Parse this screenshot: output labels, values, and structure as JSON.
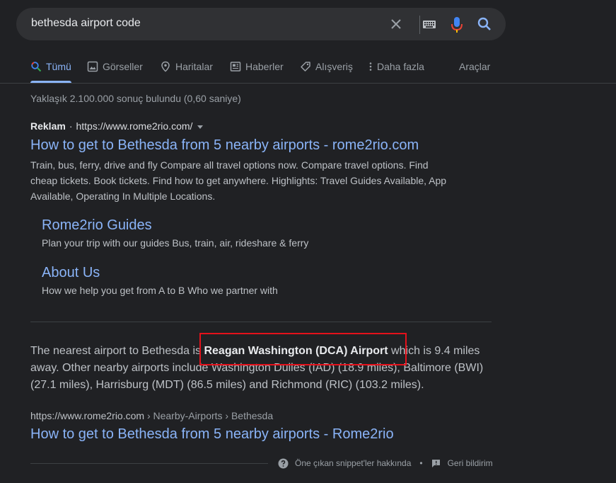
{
  "search": {
    "query": "bethesda airport code"
  },
  "tabs": [
    {
      "label": "Tümü",
      "icon": "search-icon",
      "active": true
    },
    {
      "label": "Görseller",
      "icon": "image-icon"
    },
    {
      "label": "Haritalar",
      "icon": "map-pin-icon"
    },
    {
      "label": "Haberler",
      "icon": "news-icon"
    },
    {
      "label": "Alışveriş",
      "icon": "tag-icon"
    },
    {
      "label": "Daha fazla",
      "icon": "more-vert-icon"
    }
  ],
  "tools_label": "Araçlar",
  "stats": "Yaklaşık 2.100.000 sonuç bulundu (0,60 saniye)",
  "ad": {
    "badge": "Reklam",
    "separator": "·",
    "url": "https://www.rome2rio.com/",
    "title": "How to get to Bethesda from 5 nearby airports - rome2rio.com",
    "description": "Train, bus, ferry, drive and fly Compare all travel options now. Compare travel options. Find cheap tickets. Book tickets. Find how to get anywhere. Highlights: Travel Guides Available, App Available, Operating In Multiple Locations.",
    "sitelinks": [
      {
        "title": "Rome2rio Guides",
        "desc": "Plan your trip with our guides Bus, train, air, rideshare & ferry"
      },
      {
        "title": "About Us",
        "desc": "How we help you get from A to B Who we partner with"
      }
    ]
  },
  "snippet": {
    "pre": "The nearest airport to Bethesda is ",
    "bold": "Reagan Washington (DCA) Airport",
    "post": " which is 9.4 miles away. Other nearby airports include Washington Dulles (IAD) (18.9 miles), Baltimore (BWI) (27.1 miles), Harrisburg (MDT) (86.5 miles) and Richmond (RIC) (103.2 miles)."
  },
  "result": {
    "domain": "https://www.rome2rio.com",
    "path": " › Nearby-Airports › Bethesda",
    "title": "How to get to Bethesda from 5 nearby airports - Rome2rio"
  },
  "footer": {
    "about": "Öne çıkan snippet'ler hakkında",
    "bullet": "•",
    "feedback": "Geri bildirim"
  },
  "colors": {
    "background": "#202124",
    "link": "#8ab4f8",
    "highlight": "#e4111b"
  }
}
